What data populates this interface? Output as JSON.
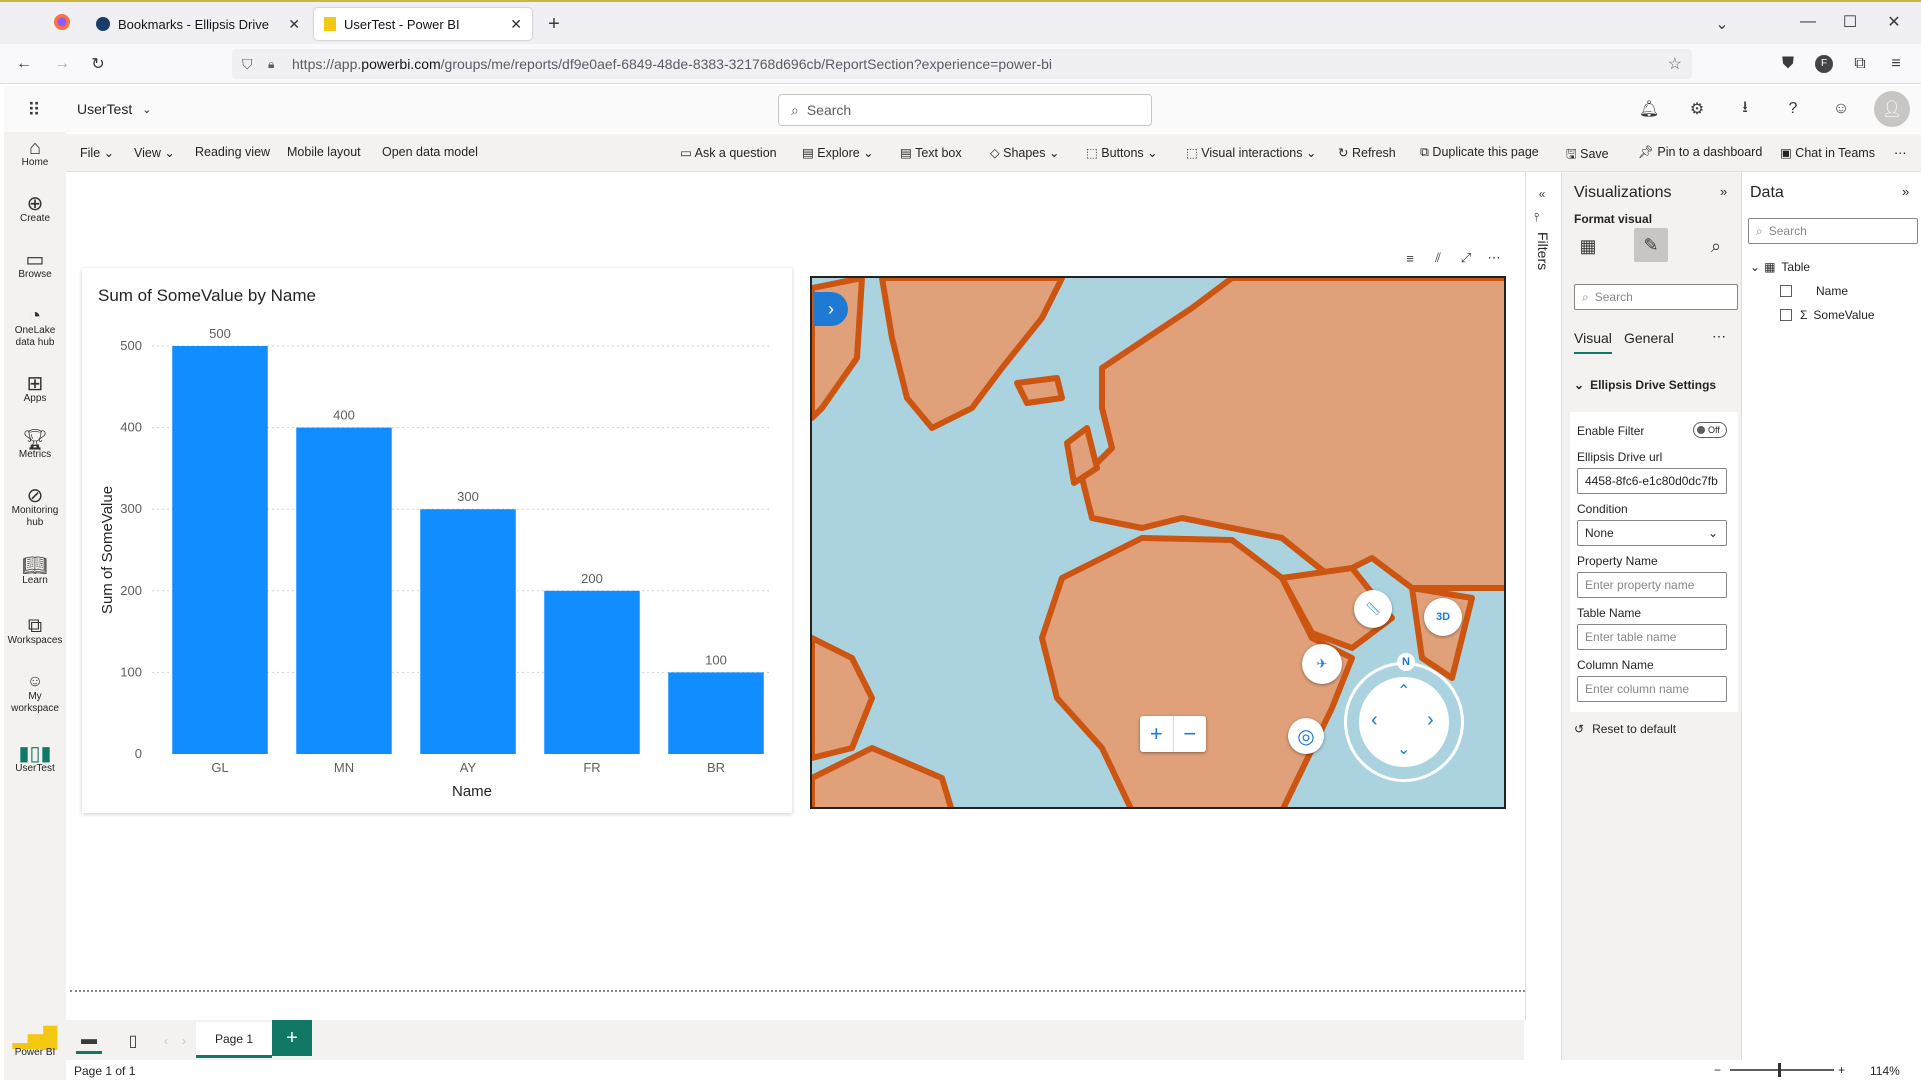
{
  "browser": {
    "tabs": [
      {
        "label": "Bookmarks - Ellipsis Drive"
      },
      {
        "label": "UserTest - Power BI"
      }
    ],
    "url_prefix": "https://app.",
    "url_domain": "powerbi.com",
    "url_rest": "/groups/me/reports/df9e0aef-6849-48de-8383-321768d696cb/ReportSection?experience=power-bi"
  },
  "header": {
    "report_name": "UserTest",
    "search_placeholder": "Search"
  },
  "ribbon": {
    "left": [
      "File",
      "View",
      "Reading view",
      "Mobile layout",
      "Open data model"
    ],
    "right": [
      "Ask a question",
      "Explore",
      "Text box",
      "Shapes",
      "Buttons",
      "Visual interactions",
      "Refresh",
      "Duplicate this page",
      "Save",
      "Pin to a dashboard",
      "Chat in Teams"
    ]
  },
  "leftnav": [
    {
      "label": "Home",
      "icon": "home-icon"
    },
    {
      "label": "Create",
      "icon": "create-icon"
    },
    {
      "label": "Browse",
      "icon": "browse-icon"
    },
    {
      "label": "OneLake data hub",
      "icon": "onelake-icon"
    },
    {
      "label": "Apps",
      "icon": "apps-icon"
    },
    {
      "label": "Metrics",
      "icon": "metrics-icon"
    },
    {
      "label": "Monitoring hub",
      "icon": "monitoring-icon"
    },
    {
      "label": "Learn",
      "icon": "learn-icon"
    },
    {
      "label": "Workspaces",
      "icon": "workspaces-icon"
    },
    {
      "label": "My workspace",
      "icon": "my-workspace-icon"
    },
    {
      "label": "UserTest",
      "icon": "report-icon"
    }
  ],
  "powerbi_label": "Power BI",
  "chart_data": {
    "type": "bar",
    "title": "Sum of SomeValue by Name",
    "categories": [
      "GL",
      "MN",
      "AY",
      "FR",
      "BR"
    ],
    "values": [
      500,
      400,
      300,
      200,
      100
    ],
    "xlabel": "Name",
    "ylabel": "Sum of SomeValue",
    "ylim": [
      0,
      500
    ],
    "yticks": [
      0,
      100,
      200,
      300,
      400,
      500
    ],
    "color": "#118dff",
    "grid": true
  },
  "map": {
    "compass_label": "N",
    "zoom_in": "+",
    "zoom_out": "−",
    "three_d": "3D"
  },
  "filters_label": "Filters",
  "viz": {
    "title": "Visualizations",
    "format_visual": "Format visual",
    "search_placeholder": "Search",
    "tab_visual": "Visual",
    "tab_general": "General",
    "section": "Ellipsis Drive Settings",
    "enable_filter": "Enable Filter",
    "toggle": "Off",
    "url_label": "Ellipsis Drive url",
    "url_value": "4458-8fc6-e1c80d0dc7fb",
    "condition_label": "Condition",
    "condition_value": "None",
    "property_label": "Property Name",
    "property_placeholder": "Enter property name",
    "table_label": "Table Name",
    "table_placeholder": "Enter table name",
    "column_label": "Column Name",
    "column_placeholder": "Enter column name",
    "reset": "Reset to default"
  },
  "data": {
    "title": "Data",
    "search_placeholder": "Search",
    "table": "Table",
    "fields": [
      "Name",
      "SomeValue"
    ]
  },
  "pages": {
    "tab": "Page 1",
    "status": "Page 1 of 1",
    "zoom": "114%"
  },
  "accent_color": "#117865"
}
